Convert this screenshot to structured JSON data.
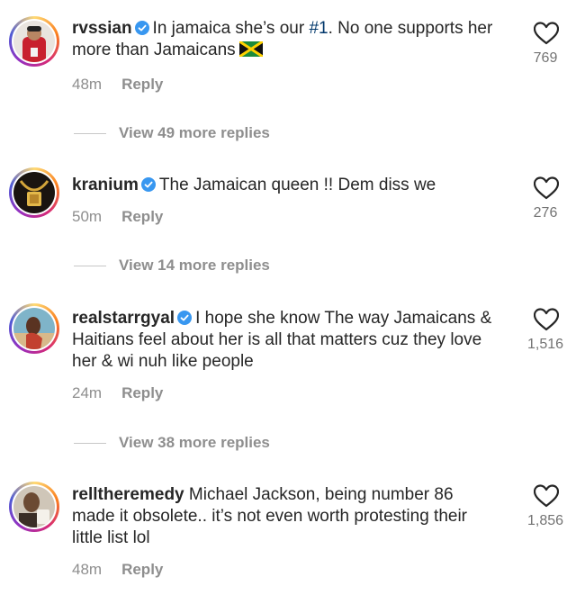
{
  "comments": [
    {
      "username": "rvssian",
      "text_before": "In jamaica she’s our ",
      "hashtag": "#1",
      "text_after": ". No one supports her more than Jamaicans",
      "time": "48m",
      "reply_label": "Reply",
      "likes": "769",
      "view_replies": "View 49 more replies"
    },
    {
      "username": "kranium",
      "text": "The Jamaican queen !! Dem diss we",
      "time": "50m",
      "reply_label": "Reply",
      "likes": "276",
      "view_replies": "View 14 more replies"
    },
    {
      "username": "realstarrgyal",
      "text": "I hope she know The way Jamaicans & Haitians feel about her is all that matters cuz they love her & wi nuh like people",
      "time": "24m",
      "reply_label": "Reply",
      "likes": "1,516",
      "view_replies": "View 38 more replies"
    },
    {
      "username": "relltheremedy",
      "text": "Michael Jackson, being number 86 made it obsolete.. it’s not even worth protesting their little list lol",
      "time": "48m",
      "reply_label": "Reply",
      "likes": "1,856"
    }
  ],
  "colors": {
    "verified": "#3897f0",
    "hashtag": "#00376b",
    "meta": "#8e8e8e"
  },
  "icons": {
    "like": "heart-outline-icon",
    "verified": "verified-badge-icon",
    "flag": "jamaica-flag-emoji"
  }
}
